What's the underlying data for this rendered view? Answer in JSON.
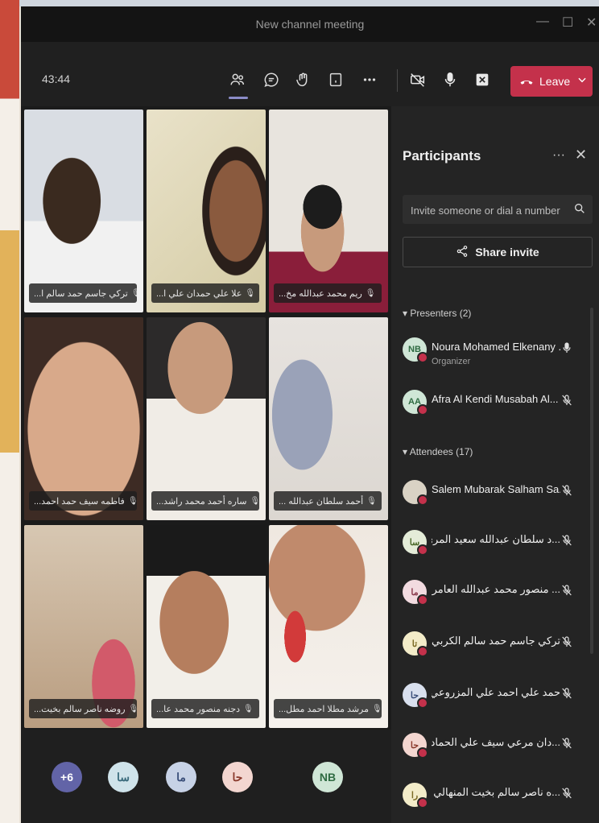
{
  "window": {
    "title": "New channel meeting"
  },
  "toolbar": {
    "timer": "43:44",
    "leave_label": "Leave",
    "accent": "#c4314b"
  },
  "tiles": [
    {
      "name": "تركي جاسم حمد سالم ا..."
    },
    {
      "name": "علا علي حمدان علي ا..."
    },
    {
      "name": "ريم محمد عبدالله مخ..."
    },
    {
      "name": "فاطمه سيف حمد احمد..."
    },
    {
      "name": "ساره أحمد محمد راشد..."
    },
    {
      "name": "أحمد سلطان عبدالله ..."
    },
    {
      "name": "روضه ناصر سالم بخيت..."
    },
    {
      "name": "دجنه منصور محمد عا..."
    },
    {
      "name": "مرشد مطلا احمد مطل..."
    }
  ],
  "bottom_avatars": [
    {
      "label": "+6",
      "color": "#6264a7"
    },
    {
      "label": "سا",
      "color": "#cfe3ea"
    },
    {
      "label": "ما",
      "color": "#c7d2e6"
    },
    {
      "label": "حا",
      "color": "#f3d6d0"
    },
    {
      "label": "NB",
      "color": "#cfe6d6"
    }
  ],
  "participants": {
    "title": "Participants",
    "invite_placeholder": "Invite someone or dial a number",
    "share_label": "Share invite",
    "presenters_label": "Presenters (2)",
    "attendees_label": "Attendees (17)",
    "presenters": [
      {
        "initials": "NB",
        "name": "Noura Mohamed Elkenany ...",
        "role": "Organizer",
        "color": "#cfe6d6"
      },
      {
        "initials": "AA",
        "name": "Afra Al Kendi Musabah Al...",
        "role": "",
        "color": "#cfe6d6"
      }
    ],
    "attendees": [
      {
        "initials": "",
        "name": "Salem Mubarak Salham Sa...",
        "color": "#d9d2c4"
      },
      {
        "initials": "سا",
        "name": "...د سلطان عبدالله سعيد المري",
        "color": "#e4ecd8"
      },
      {
        "initials": "ما",
        "name": "... منصور محمد عبدالله العامري",
        "color": "#f2dbe0"
      },
      {
        "initials": "تا",
        "name": "تركي جاسم حمد سالم الكربي",
        "color": "#f3ecc9"
      },
      {
        "initials": "حا",
        "name": "حمد علي احمد علي المزروعي",
        "color": "#d9e0ee"
      },
      {
        "initials": "حا",
        "name": "...دان مرعي سيف علي الحمادي",
        "color": "#f3d6d0"
      },
      {
        "initials": "را",
        "name": "...ه ناصر سالم بخيت المنهالي",
        "color": "#f3ecc9"
      }
    ]
  }
}
